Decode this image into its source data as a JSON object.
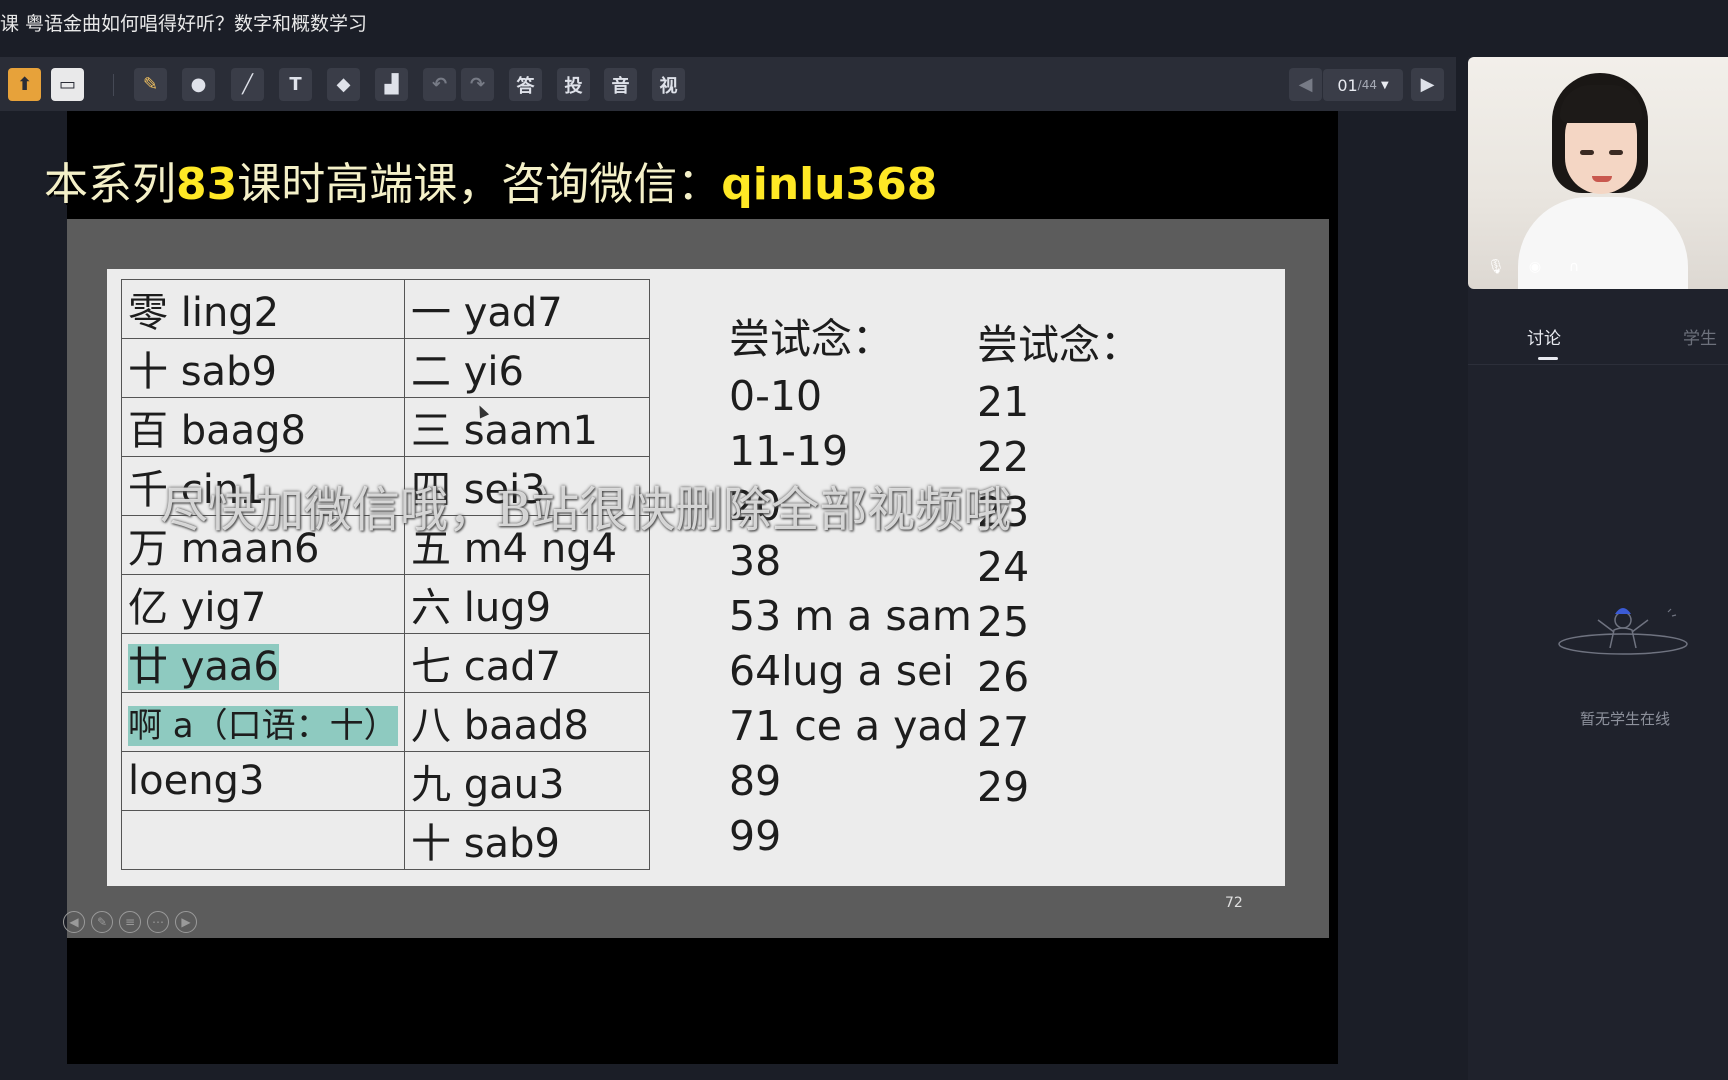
{
  "window": {
    "title": "课 粤语金曲如何唱得好听？数字和概数学习"
  },
  "toolbar": {
    "tools": [
      {
        "name": "upload-icon",
        "glyph": "⬆"
      },
      {
        "name": "desk-icon",
        "glyph": "▭"
      },
      {
        "name": "brush-icon",
        "glyph": "✎"
      },
      {
        "name": "shape-icon",
        "glyph": "●"
      },
      {
        "name": "line-icon",
        "glyph": "╱"
      },
      {
        "name": "text-icon",
        "glyph": "T"
      },
      {
        "name": "eraser-icon",
        "glyph": "◆"
      },
      {
        "name": "clear-icon",
        "glyph": "▟"
      },
      {
        "name": "undo-icon",
        "glyph": "↶"
      },
      {
        "name": "redo-icon",
        "glyph": "↷"
      }
    ],
    "answer_label": "答",
    "vote_label": "投",
    "audio_label": "音",
    "video_label": "视",
    "page_current": "01",
    "page_total": "/44"
  },
  "banner": {
    "prefix": "本系列",
    "count": "83",
    "middle": "课时高端课，咨询微信：",
    "wechat": "qinlu368"
  },
  "slide": {
    "table_rows": [
      [
        "零 ling2",
        "一 yad7"
      ],
      [
        "十 sab9",
        "二 yi6"
      ],
      [
        "百 baag8",
        "三 saam1"
      ],
      [
        "千 cin1",
        "四 sei3"
      ],
      [
        "万 maan6",
        "五 m4 ng4"
      ],
      [
        "亿 yig7",
        "六 lug9"
      ],
      [
        "廿 yaa6",
        "七 cad7"
      ],
      [
        "啊 a（口语：十）",
        "八 baad8"
      ],
      [
        "loeng3",
        "九 gau3"
      ],
      [
        "",
        "十 sab9"
      ]
    ],
    "practice_head": "尝试念：",
    "practice_1": [
      "0-10",
      "11-19",
      "20",
      "38",
      "53 m a sam",
      "64lug a sei",
      "71 ce a yad",
      "89",
      "99"
    ],
    "practice_2": [
      "21",
      "22",
      "23",
      "24",
      "25",
      "26",
      "27",
      "29"
    ],
    "page_number": "72"
  },
  "overlay": {
    "text": "尽快加微信哦，B站很快删除全部视频哦"
  },
  "side": {
    "tab_discuss": "讨论",
    "tab_students": "学生",
    "empty_text": "暂无学生在线"
  }
}
